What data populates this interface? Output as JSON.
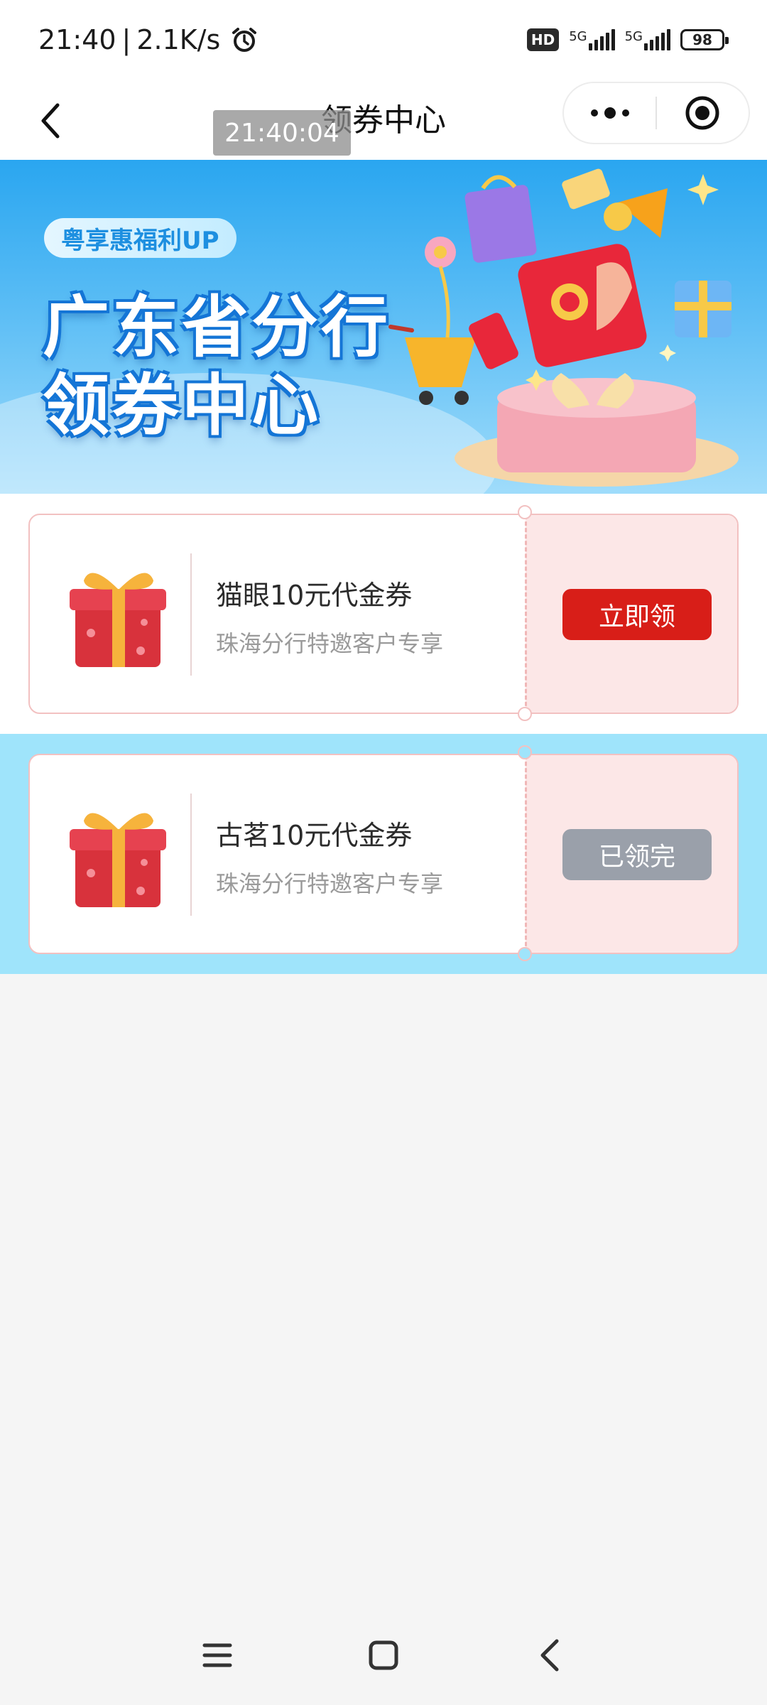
{
  "status_bar": {
    "time": "21:40",
    "speed": "2.1K/s",
    "hd_label": "HD",
    "network_1": "5G",
    "network_2": "5G",
    "battery": "98"
  },
  "nav": {
    "title": "领券中心",
    "time_overlay": "21:40:04"
  },
  "banner": {
    "tag": "粤享惠福利UP",
    "title_line1": "广东省分行",
    "title_line2": "领券中心"
  },
  "coupons": [
    {
      "title": "猫眼10元代金券",
      "subtitle": "珠海分行特邀客户专享",
      "button": "立即领",
      "state": "available"
    },
    {
      "title": "古茗10元代金券",
      "subtitle": "珠海分行特邀客户专享",
      "button": "已领完",
      "state": "sold-out"
    }
  ],
  "colors": {
    "claim_button": "#d81e18",
    "done_button": "#9aa0aa",
    "banner_blue": "#2aa6f0",
    "coupon_border": "#f2c1c1"
  }
}
